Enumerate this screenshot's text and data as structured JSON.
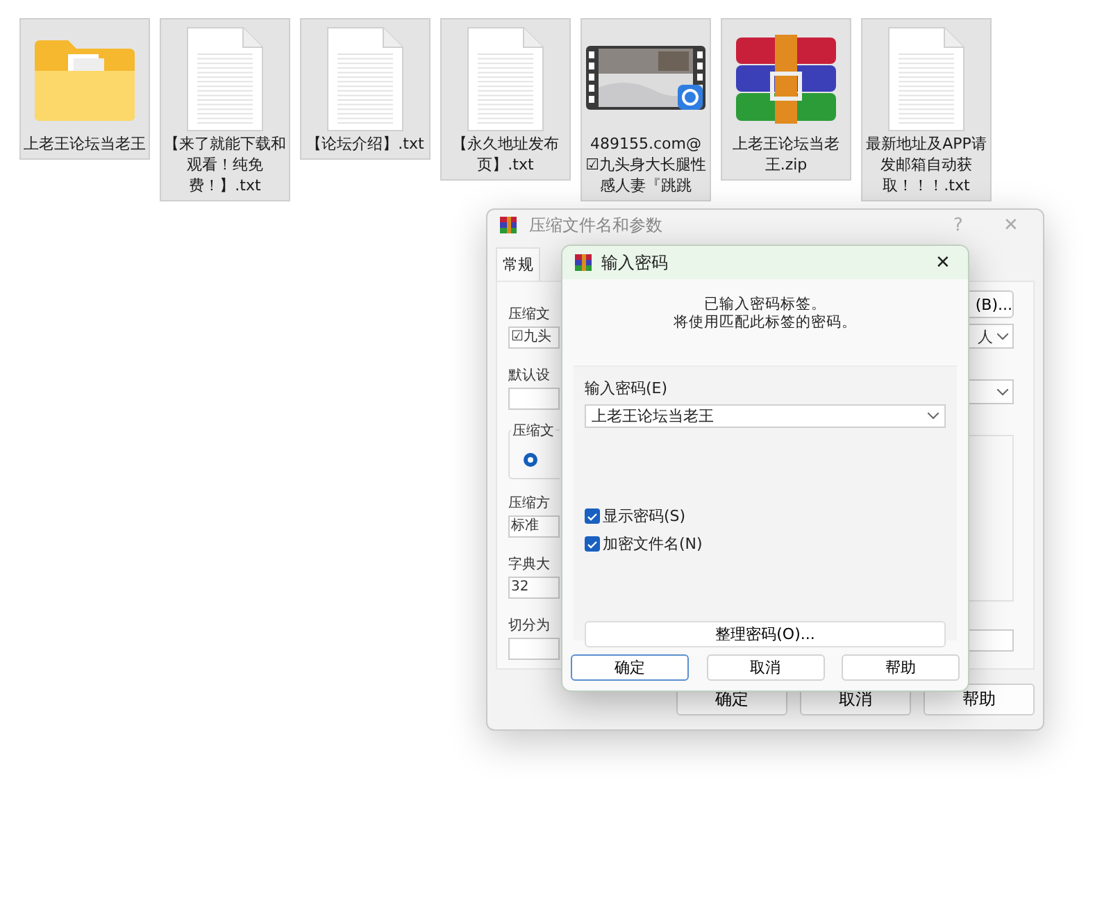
{
  "files": [
    {
      "name": "上老王论坛当老王",
      "kind": "folder"
    },
    {
      "name": "【来了就能下载和观看！纯免费！】.txt",
      "kind": "text"
    },
    {
      "name": "【论坛介绍】.txt",
      "kind": "text"
    },
    {
      "name": "【永久地址发布页】.txt",
      "kind": "text"
    },
    {
      "name": "489155.com@☑九头身大长腿性感人妻『跳跳",
      "kind": "video"
    },
    {
      "name": "上老王论坛当老王.zip",
      "kind": "archive"
    },
    {
      "name": "最新地址及APP请发邮箱自动获取！！！.txt",
      "kind": "text"
    }
  ],
  "archive_dialog": {
    "title": "压缩文件名和参数",
    "help_glyph": "?",
    "close_glyph": "✕",
    "tabs": [
      {
        "label": "常规",
        "selected": true
      }
    ],
    "left": [
      {
        "kind": "label",
        "text": "压缩文"
      },
      {
        "kind": "field",
        "text": "☑九头"
      },
      {
        "kind": "label",
        "text": "默认设"
      },
      {
        "kind": "field"
      },
      {
        "kind": "group",
        "text": "压缩文",
        "selected": true
      },
      {
        "kind": "label",
        "text": "压缩方"
      },
      {
        "kind": "field",
        "text": "标准"
      },
      {
        "kind": "label",
        "text": "字典大"
      },
      {
        "kind": "field",
        "text": "32"
      },
      {
        "kind": "label",
        "text": "切分为"
      },
      {
        "kind": "field"
      }
    ],
    "right": [
      {
        "kind": "button",
        "text": "(B)..."
      },
      {
        "kind": "dropdown",
        "text": "人"
      },
      {
        "kind": "dropdown"
      },
      {
        "kind": "panel"
      },
      {
        "kind": "field"
      }
    ],
    "buttons": [
      "确定",
      "取消",
      "帮助"
    ]
  },
  "password_dialog": {
    "title": "输入密码",
    "close_glyph": "✕",
    "message": [
      "已输入密码标签。",
      "将使用匹配此标签的密码。"
    ],
    "password_label": "输入密码(E)",
    "password_value": "上老王论坛当老王",
    "options": [
      {
        "label": "显示密码(S)",
        "checked": true
      },
      {
        "label": "加密文件名(N)",
        "checked": true
      }
    ],
    "organize_button": "整理密码(O)...",
    "buttons": [
      {
        "label": "确定",
        "default": true
      },
      {
        "label": "取消",
        "default": false
      },
      {
        "label": "帮助",
        "default": false
      }
    ]
  }
}
